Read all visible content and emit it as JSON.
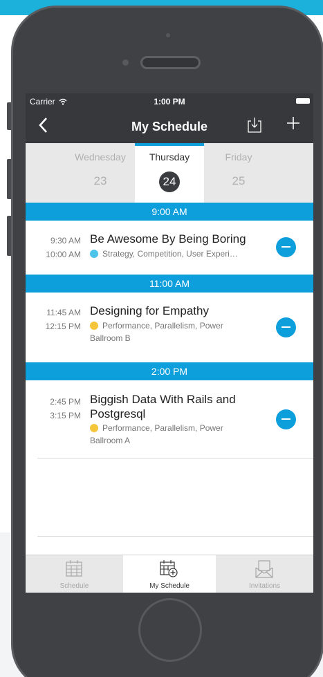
{
  "status_bar": {
    "carrier": "Carrier",
    "time": "1:00 PM"
  },
  "navbar": {
    "title": "My Schedule",
    "back_icon": "chevron-left-icon",
    "download_icon": "download-icon",
    "add_icon": "plus-icon"
  },
  "days": [
    {
      "name": "Wednesday",
      "number": "23"
    },
    {
      "name": "Thursday",
      "number": "24",
      "selected": true
    },
    {
      "name": "Friday",
      "number": "25"
    }
  ],
  "time_headers": [
    "9:00 AM",
    "11:00 AM",
    "2:00 PM"
  ],
  "sessions": [
    {
      "start": "9:30 AM",
      "end": "10:00 AM",
      "title": "Be Awesome By Being Boring",
      "track": "Strategy, Competition, User Experi…",
      "track_color": "#4cc3e8",
      "room": ""
    },
    {
      "start": "11:45 AM",
      "end": "12:15 PM",
      "title": "Designing for Empathy",
      "track": "Performance, Parallelism, Power",
      "track_color": "#f5c63a",
      "room": "Ballroom B"
    },
    {
      "start": "2:45 PM",
      "end": "3:15 PM",
      "title": "Biggish Data With Rails and Postgresql",
      "track": "Performance, Parallelism, Power",
      "track_color": "#f5c63a",
      "room": "Ballroom A"
    }
  ],
  "tabs": [
    {
      "label": "Schedule",
      "icon": "calendar-grid-icon"
    },
    {
      "label": "My Schedule",
      "icon": "calendar-add-icon",
      "selected": true
    },
    {
      "label": "Invitations",
      "icon": "envelope-icon"
    }
  ],
  "colors": {
    "accent": "#0d9fdc",
    "navbar": "#36383c",
    "phone": "#3f4144",
    "background_top": "#1bb1da"
  }
}
